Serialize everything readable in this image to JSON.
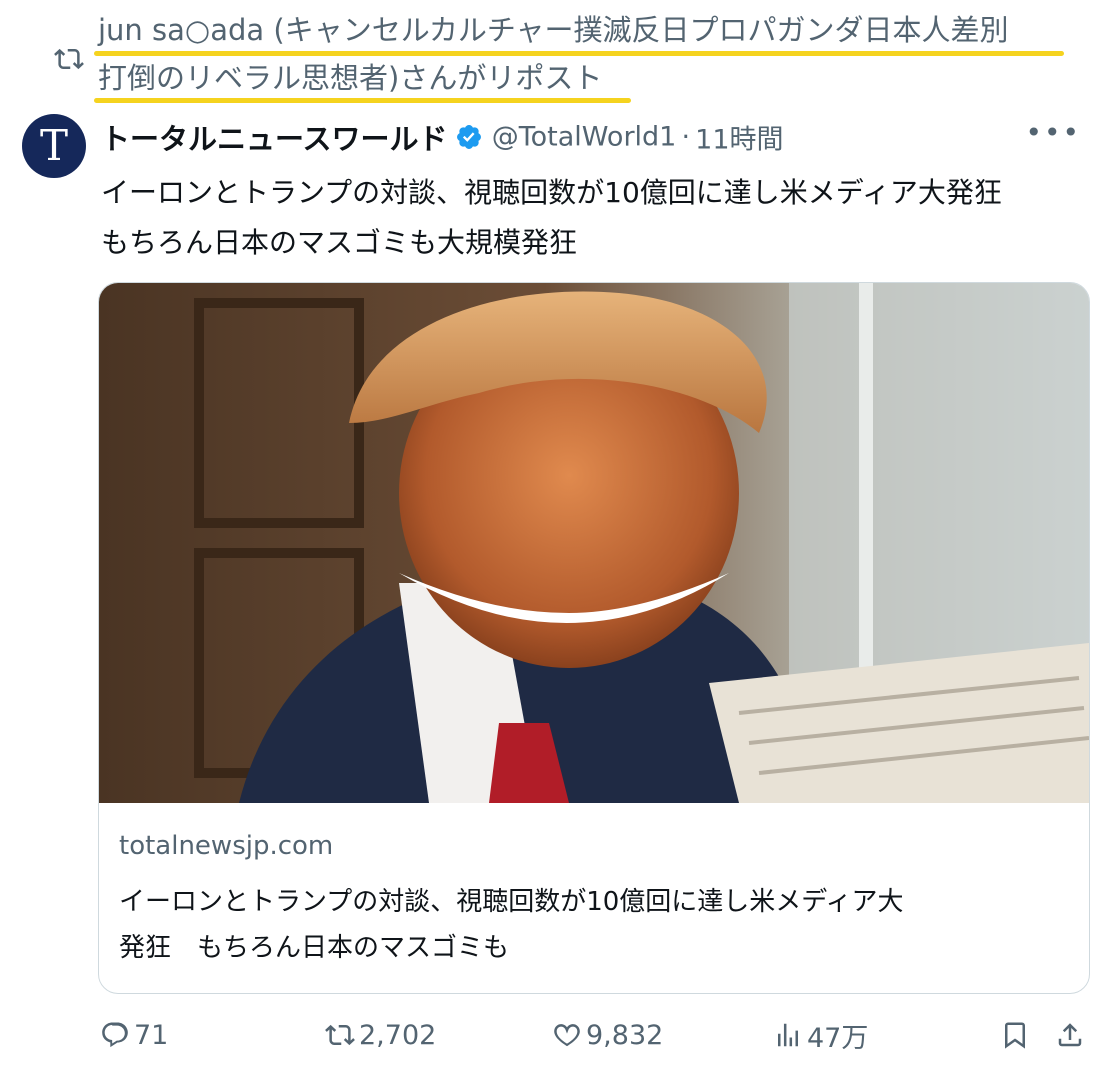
{
  "repost": {
    "line1": "jun sa○ada (キャンセルカルチャー撲滅反日プロパガンダ日本人差別",
    "line2": "打倒のリベラル思想者)さんがリポスト",
    "highlight_color": "#f5d31f"
  },
  "author": {
    "avatar_letter": "T",
    "display_name": "トータルニュースワールド",
    "handle": "@TotalWorld1",
    "separator": "·",
    "time": "11時間",
    "verified": true
  },
  "tweet": {
    "line1": "イーロンとトランプの対談、視聴回数が10億回に達し米メディア大発狂",
    "line2": "もちろん日本のマスゴミも大規模発狂"
  },
  "card": {
    "domain": "totalnewsjp.com",
    "title_line1": "イーロンとトランプの対談、視聴回数が10億回に達し米メディア大",
    "title_line2": "発狂　もちろん日本のマスゴミも"
  },
  "actions": {
    "replies": "71",
    "reposts": "2,702",
    "likes": "9,832",
    "views": "47万"
  },
  "colors": {
    "text": "#0f1419",
    "secondary": "#536471",
    "verified": "#1d9bf0",
    "avatar_bg": "#15285a",
    "border": "#cfd9de"
  },
  "icons": [
    "repost-icon",
    "verified-badge-icon",
    "more-icon",
    "reply-icon",
    "like-icon",
    "views-icon",
    "bookmark-icon",
    "share-icon"
  ]
}
